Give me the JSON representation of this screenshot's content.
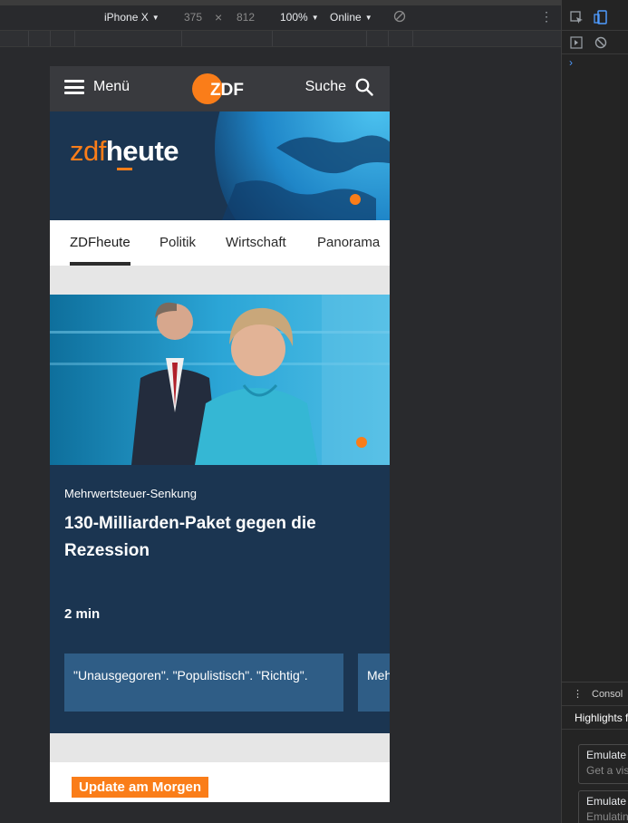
{
  "device_toolbar": {
    "device": "iPhone X",
    "width": "375",
    "times": "×",
    "height": "812",
    "zoom": "100%",
    "network": "Online"
  },
  "devtools": {
    "drawer_tab": "Consol",
    "drawer_heading": "Highlights f",
    "cards": [
      {
        "title": "Emulate",
        "subtitle": "Get a vis"
      },
      {
        "title": "Emulate",
        "subtitle": "Emulatin"
      }
    ]
  },
  "site": {
    "header": {
      "menu_label": "Menü",
      "logo_text": "ZDF",
      "search_label": "Suche"
    },
    "brand": {
      "part1": "zdf",
      "part2": "heute"
    },
    "tabs": [
      {
        "label": "ZDFheute",
        "active": true
      },
      {
        "label": "Politik",
        "active": false
      },
      {
        "label": "Wirtschaft",
        "active": false
      },
      {
        "label": "Panorama",
        "active": false
      }
    ],
    "teaser": {
      "kicker": "Mehrwertsteuer-Senkung",
      "title": "130-Milliarden-Paket gegen die Rezession",
      "duration": "2 min",
      "related": [
        {
          "label": "\"Unausgegoren\". \"Populistisch\". \"Richtig\"."
        },
        {
          "label": "Meh"
        }
      ]
    },
    "update_label": "Update am Morgen"
  },
  "colors": {
    "zdf_orange": "#fa7d19",
    "zdf_navy": "#1b3551",
    "header_gray": "#393a3e",
    "related_blue": "#2f5d86"
  }
}
